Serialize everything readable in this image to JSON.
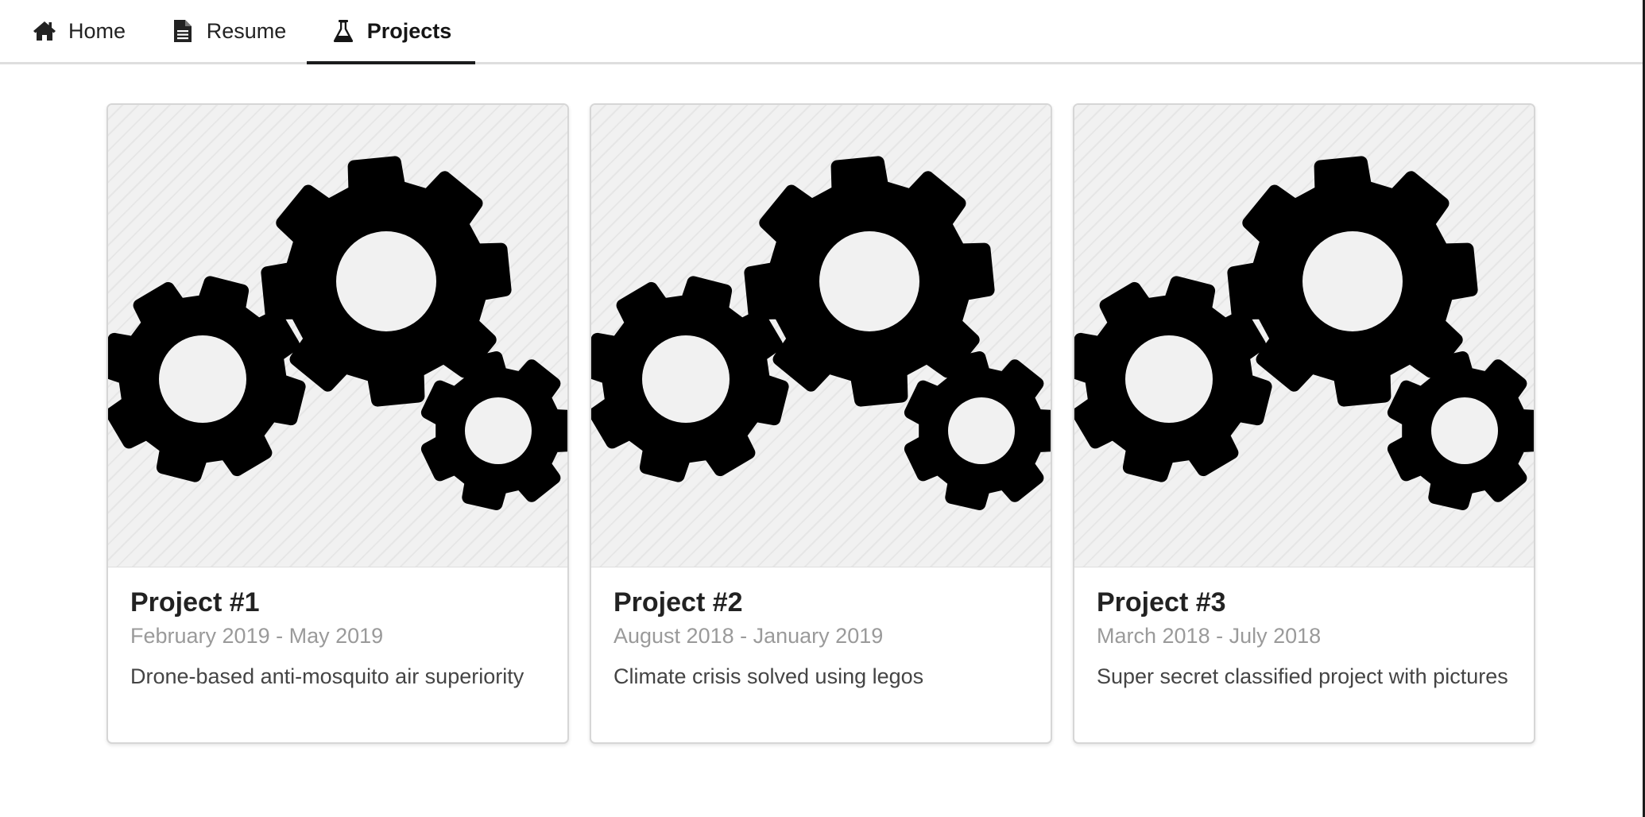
{
  "nav": {
    "tabs": [
      {
        "label": "Home",
        "icon": "home-icon",
        "active": false
      },
      {
        "label": "Resume",
        "icon": "document-icon",
        "active": false
      },
      {
        "label": "Projects",
        "icon": "flask-icon",
        "active": true
      }
    ]
  },
  "projects": [
    {
      "title": "Project #1",
      "dates": "February 2019 - May 2019",
      "description": "Drone-based anti-mosquito air superiority",
      "image_icon": "gears-icon"
    },
    {
      "title": "Project #2",
      "dates": "August 2018 - January 2019",
      "description": "Climate crisis solved using legos",
      "image_icon": "gears-icon"
    },
    {
      "title": "Project #3",
      "dates": "March 2018 - July 2018",
      "description": "Super secret classified project with pictures",
      "image_icon": "gears-icon"
    }
  ],
  "colors": {
    "active_tab_underline": "#1b1c1d",
    "text_primary": "#222222",
    "text_meta": "#9a9a9a",
    "card_border": "#d6d6d6",
    "image_background": "#f1f1f1"
  }
}
